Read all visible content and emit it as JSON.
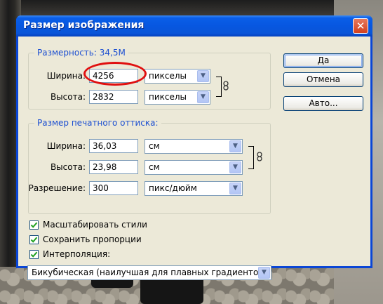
{
  "window": {
    "title": "Размер изображения",
    "close_icon": "close-icon"
  },
  "pixel_dimensions": {
    "legend": "Размерность:  34,5М",
    "width": {
      "label": "Ширина:",
      "value": "4256",
      "unit": "пикселы"
    },
    "height": {
      "label": "Высота:",
      "value": "2832",
      "unit": "пикселы"
    }
  },
  "document_size": {
    "legend": "Размер печатного оттиска:",
    "width": {
      "label": "Ширина:",
      "value": "36,03",
      "unit": "см"
    },
    "height": {
      "label": "Высота:",
      "value": "23,98",
      "unit": "см"
    },
    "resolution": {
      "label": "Разрешение:",
      "value": "300",
      "unit": "пикс/дюйм"
    }
  },
  "buttons": {
    "ok": "Да",
    "cancel": "Отмена",
    "auto": "Авто..."
  },
  "options": {
    "scale_styles": {
      "label": "Масштабировать стили",
      "checked": true
    },
    "constrain": {
      "label": "Сохранить пропорции",
      "checked": true
    },
    "resample": {
      "label": "Интерполяция:",
      "checked": true
    },
    "method": "Бикубическая (наилучшая для плавных градиентов)"
  },
  "colors": {
    "accent": "#1c4fd1",
    "titlebar": "#0a5ee8",
    "highlight": "#e01010",
    "check": "#21a121"
  }
}
